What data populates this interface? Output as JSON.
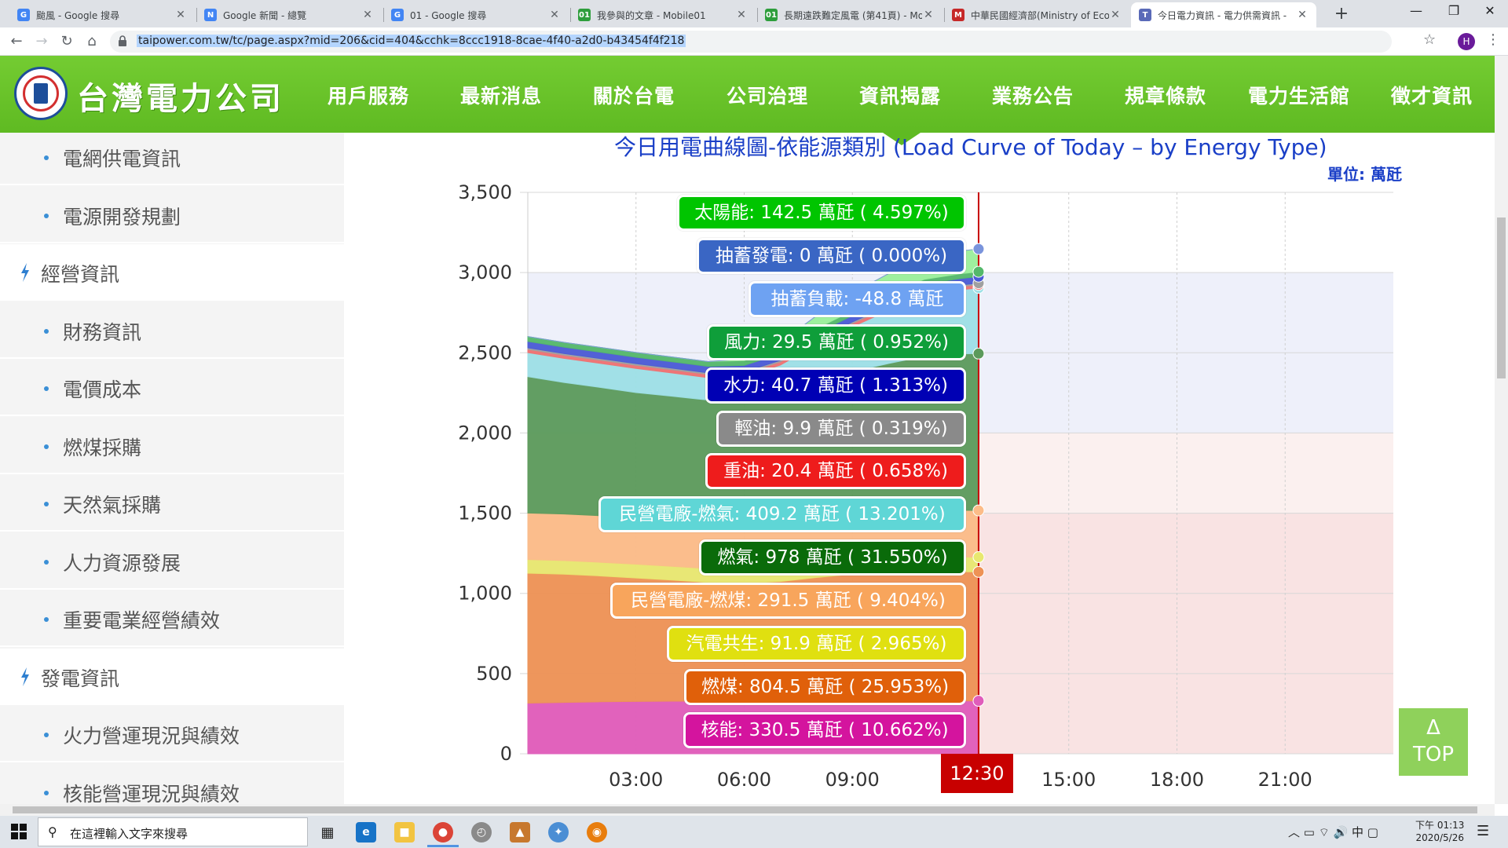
{
  "browser": {
    "tabs": [
      {
        "title": "颱風 - Google 搜尋",
        "favicon": "G",
        "color": "#4285f4"
      },
      {
        "title": "Google 新聞 - 總覽",
        "favicon": "N",
        "color": "#4285f4"
      },
      {
        "title": "01 - Google 搜尋",
        "favicon": "G",
        "color": "#4285f4"
      },
      {
        "title": "我參與的文章 - Mobile01",
        "favicon": "01",
        "color": "#2e9e3c"
      },
      {
        "title": "長期遠跌難定風電 (第41頁) - Mo",
        "favicon": "01",
        "color": "#2e9e3c"
      },
      {
        "title": "中華民國經濟部(Ministry of Ecor",
        "favicon": "M",
        "color": "#c62828"
      },
      {
        "title": "今日電力資訊 - 電力供需資訊 - ",
        "favicon": "T",
        "color": "#5a6ab8"
      }
    ],
    "close_glyph": "✕",
    "new_tab_glyph": "+",
    "url": "taipower.com.tw/tc/page.aspx?mid=206&cid=404&cchk=8ccc1918-8cae-4f40-a2d0-b43454f4f218",
    "profile_initial": "H"
  },
  "site": {
    "logo_text": "台灣電力公司",
    "nav": [
      "用戶服務",
      "最新消息",
      "關於台電",
      "公司治理",
      "資訊揭露",
      "業務公告",
      "規章條款",
      "電力生活館",
      "徵才資訊"
    ]
  },
  "sidebar": {
    "items": [
      {
        "type": "sub",
        "label": "電網供電資訊"
      },
      {
        "type": "sub",
        "label": "電源開發規劃"
      },
      {
        "type": "head",
        "label": "經營資訊"
      },
      {
        "type": "sub",
        "label": "財務資訊"
      },
      {
        "type": "sub",
        "label": "電價成本"
      },
      {
        "type": "sub",
        "label": "燃煤採購"
      },
      {
        "type": "sub",
        "label": "天然氣採購"
      },
      {
        "type": "sub",
        "label": "人力資源發展"
      },
      {
        "type": "sub",
        "label": "重要電業經營績效"
      },
      {
        "type": "head",
        "label": "發電資訊"
      },
      {
        "type": "sub",
        "label": "火力營運現況與績效"
      },
      {
        "type": "sub",
        "label": "核能營運現況與績效"
      }
    ]
  },
  "chart_title": "今日用電曲線圖-依能源類別 (Load Curve of Today – by Energy Type)",
  "unit_label": "單位: 萬瓩",
  "current_time": "12:30",
  "top_button": {
    "arrow": "Δ",
    "label": "TOP"
  },
  "tooltips": [
    {
      "text": "太陽能: 142.5 萬瓩 ( 4.597%)",
      "color": "#00c500"
    },
    {
      "text": "抽蓄發電: 0 萬瓩 ( 0.000%)",
      "color": "#3a66c4"
    },
    {
      "text": "抽蓄負載: -48.8 萬瓩",
      "color": "#6ea2f2"
    },
    {
      "text": "風力: 29.5 萬瓩 ( 0.952%)",
      "color": "#0f9e3a"
    },
    {
      "text": "水力: 40.7 萬瓩 ( 1.313%)",
      "color": "#0000b4"
    },
    {
      "text": "輕油: 9.9 萬瓩 ( 0.319%)",
      "color": "#8a8a8a"
    },
    {
      "text": "重油: 20.4 萬瓩 ( 0.658%)",
      "color": "#ee1c1c"
    },
    {
      "text": "民營電廠-燃氣: 409.2 萬瓩 ( 13.201%)",
      "color": "#5fd6d6"
    },
    {
      "text": "燃氣: 978 萬瓩 ( 31.550%)",
      "color": "#0a6b0a"
    },
    {
      "text": "民營電廠-燃煤: 291.5 萬瓩 ( 9.404%)",
      "color": "#f8a55c"
    },
    {
      "text": "汽電共生: 91.9 萬瓩 ( 2.965%)",
      "color": "#e0e010"
    },
    {
      "text": "燃煤: 804.5 萬瓩 ( 25.953%)",
      "color": "#e0600a"
    },
    {
      "text": "核能: 330.5 萬瓩 ( 10.662%)",
      "color": "#d4149e"
    }
  ],
  "taskbar": {
    "search_placeholder": "在這裡輸入文字來搜尋",
    "tray_text": "︿  ▭  ⌔  🔊  中  ▢",
    "time": "下午 01:13",
    "date": "2020/5/26"
  },
  "chart_data": {
    "type": "area",
    "stacked": true,
    "xlim": [
      0,
      24
    ],
    "ylim": [
      0,
      3500
    ],
    "yticks": [
      0,
      500,
      1000,
      1500,
      2000,
      2500,
      3000,
      3500
    ],
    "ytick_labels": [
      "0",
      "500",
      "1,000",
      "1,500",
      "2,000",
      "2,500",
      "3,000",
      "3,500"
    ],
    "xticks": [
      3,
      6,
      9,
      15,
      18,
      21
    ],
    "xtick_labels": [
      "03:00",
      "06:00",
      "09:00",
      "15:00",
      "18:00",
      "21:00"
    ],
    "bands": [
      {
        "from": 3000,
        "to": 3500,
        "color": "#ffffff"
      },
      {
        "from": 2000,
        "to": 3000,
        "color": "#eef0fa"
      },
      {
        "from": 1500,
        "to": 2000,
        "color": "#fbf0ef"
      },
      {
        "from": 0,
        "to": 1500,
        "color": "#f9e3e3"
      }
    ],
    "current_x": 12.5,
    "x": [
      0,
      1,
      2,
      3,
      4,
      5,
      6,
      7,
      8,
      9,
      10,
      11,
      12,
      12.5
    ],
    "series": [
      {
        "name": "核能",
        "color": "#e05cba",
        "values": [
          316,
          320,
          324,
          326,
          328,
          328,
          328,
          329,
          329,
          330,
          330,
          330,
          330,
          330
        ]
      },
      {
        "name": "燃煤",
        "color": "#ee9255",
        "values": [
          810,
          800,
          785,
          770,
          755,
          740,
          735,
          745,
          770,
          790,
          800,
          805,
          805,
          804
        ]
      },
      {
        "name": "汽電共生",
        "color": "#e8e870",
        "values": [
          85,
          85,
          85,
          86,
          86,
          87,
          88,
          89,
          90,
          91,
          92,
          92,
          92,
          92
        ]
      },
      {
        "name": "民營電廠-燃煤",
        "color": "#fcbc88",
        "values": [
          290,
          290,
          290,
          290,
          290,
          290,
          290,
          290,
          291,
          291,
          291,
          291,
          291,
          291
        ]
      },
      {
        "name": "燃氣",
        "color": "#5b9a5b",
        "values": [
          850,
          820,
          800,
          780,
          770,
          760,
          760,
          790,
          840,
          880,
          920,
          960,
          975,
          978
        ]
      },
      {
        "name": "民營電廠-燃氣",
        "color": "#9de0e6",
        "values": [
          150,
          150,
          150,
          150,
          145,
          140,
          150,
          180,
          230,
          280,
          330,
          380,
          400,
          409
        ]
      },
      {
        "name": "重油",
        "color": "#f07070",
        "values": [
          20,
          20,
          20,
          20,
          20,
          20,
          20,
          20,
          20,
          20,
          20,
          20,
          20,
          20
        ]
      },
      {
        "name": "輕油",
        "color": "#a0a0a0",
        "values": [
          10,
          10,
          10,
          10,
          10,
          10,
          10,
          10,
          10,
          10,
          10,
          10,
          10,
          10
        ]
      },
      {
        "name": "水力",
        "color": "#4a5ad6",
        "values": [
          40,
          40,
          40,
          40,
          40,
          40,
          40,
          40,
          40,
          40,
          40,
          40,
          40,
          41
        ]
      },
      {
        "name": "風力",
        "color": "#54b86a",
        "values": [
          30,
          30,
          30,
          30,
          30,
          30,
          30,
          30,
          30,
          30,
          30,
          30,
          30,
          30
        ]
      },
      {
        "name": "太陽能",
        "color": "#9af09a",
        "values": [
          0,
          0,
          0,
          0,
          0,
          0,
          10,
          40,
          80,
          110,
          130,
          140,
          142,
          142
        ]
      },
      {
        "name": "抽蓄發電",
        "color": "#7a94dc",
        "values": [
          0,
          0,
          0,
          0,
          0,
          0,
          0,
          0,
          0,
          0,
          0,
          0,
          0,
          0
        ]
      }
    ]
  }
}
